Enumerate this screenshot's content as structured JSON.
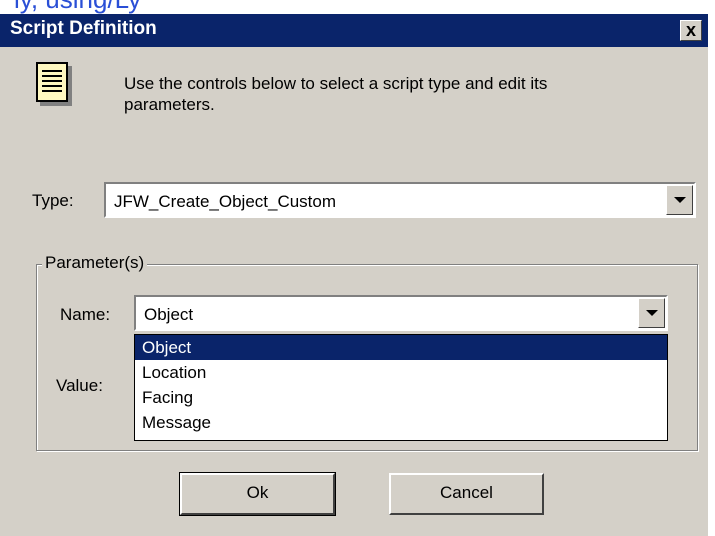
{
  "top_partial_text": "ly, using/Ly",
  "dialog": {
    "title": "Script Definition",
    "close_symbol": "x",
    "icon": "notepad-icon",
    "intro_line1": "Use the controls below to select a script type and edit its",
    "intro_line2": "parameters."
  },
  "type_field": {
    "label": "Type:",
    "value": "JFW_Create_Object_Custom"
  },
  "parameters_group": {
    "legend": "Parameter(s)",
    "name_label": "Name:",
    "name_value": "Object",
    "value_label": "Value:",
    "options": [
      "Object",
      "Location",
      "Facing",
      "Message"
    ],
    "selected_option": "Object"
  },
  "buttons": {
    "ok_label": "Ok",
    "cancel_label": "Cancel"
  },
  "colors": {
    "titlebar": "#0a246a",
    "dialog_face": "#d4d0c8",
    "selection": "#0a246a"
  }
}
